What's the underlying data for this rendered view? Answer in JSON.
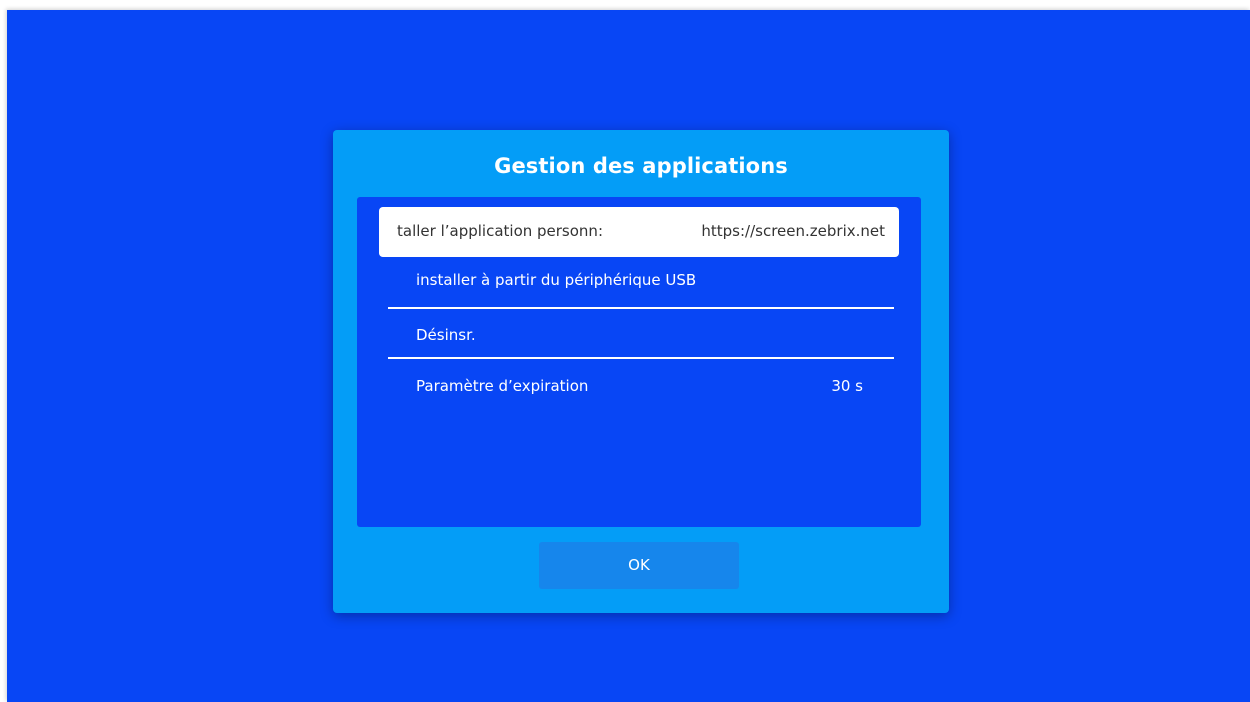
{
  "dialog": {
    "title": "Gestion des applications",
    "items": [
      {
        "label": "taller l’application personn:",
        "value": "https://screen.zebrix.net"
      },
      {
        "label": "installer à partir du périphérique USB"
      },
      {
        "label": "Désinsr."
      },
      {
        "label": "Paramètre d’expiration",
        "value": "30 s"
      }
    ],
    "ok_label": "OK"
  },
  "colors": {
    "screen_background": "#0846f5",
    "dialog_background": "#049df7",
    "list_background": "#0846f5",
    "selected_row": "#ffffff",
    "button": "#1686ec"
  }
}
